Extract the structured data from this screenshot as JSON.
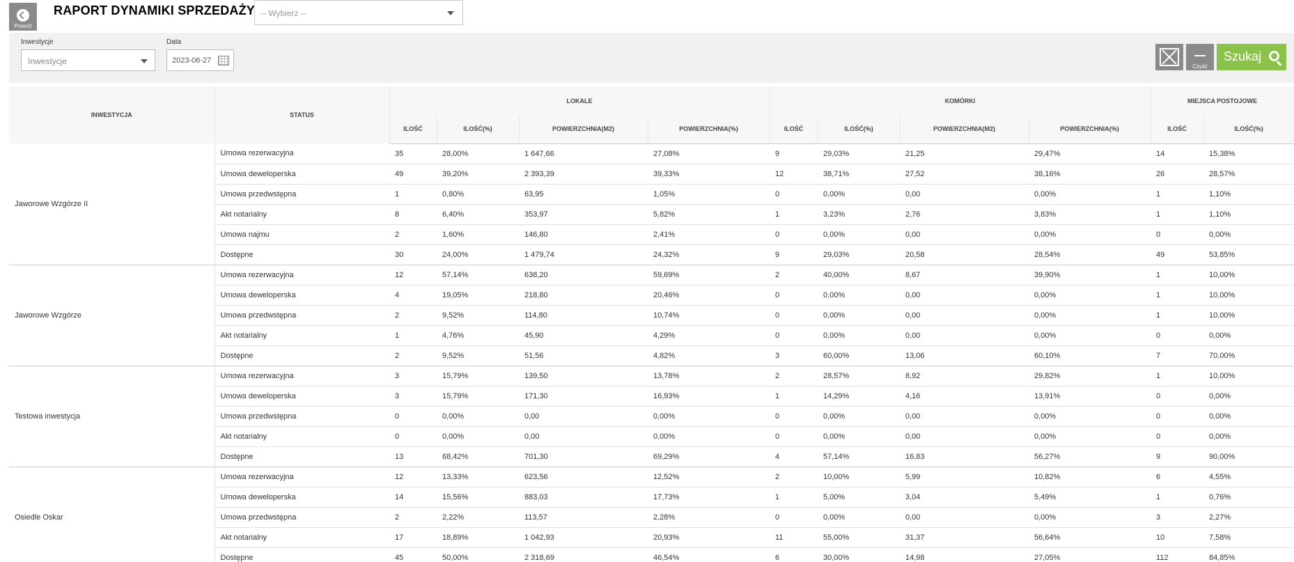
{
  "header": {
    "back_label": "Powrót",
    "title": "RAPORT DYNAMIKI SPRZEDAŻY",
    "report_select_placeholder": "-- Wybierz --"
  },
  "filters": {
    "investment_label": "Inwestycje",
    "investment_placeholder": "Inwestycje",
    "date_label": "Data",
    "date_value": "2023-06-27",
    "clear_label": "Czyść",
    "search_label": "Szukaj"
  },
  "table": {
    "head": {
      "investment": "INWESTYCJA",
      "status": "STATUS",
      "groups": [
        "LOKALE",
        "KOMÓRKI",
        "MIEJSCA POSTOJOWE"
      ],
      "cols": [
        "ILOŚĆ",
        "ILOŚĆ(%)",
        "POWIERZCHNIA(M2)",
        "POWIERZCHNIA(%)",
        "ILOŚĆ",
        "ILOŚĆ(%)",
        "POWIERZCHNIA(M2)",
        "POWIERZCHNIA(%)",
        "ILOŚĆ",
        "ILOŚĆ(%)"
      ]
    },
    "groups": [
      {
        "investment": "Jaworowe Wzgórze II",
        "rows": [
          {
            "status": "Umowa rezerwacyjna",
            "cells": [
              "35",
              "28,00%",
              "1 647,66",
              "27,08%",
              "9",
              "29,03%",
              "21,25",
              "29,47%",
              "14",
              "15,38%"
            ]
          },
          {
            "status": "Umowa deweloperska",
            "cells": [
              "49",
              "39,20%",
              "2 393,39",
              "39,33%",
              "12",
              "38,71%",
              "27,52",
              "38,16%",
              "26",
              "28,57%"
            ]
          },
          {
            "status": "Umowa przedwstępna",
            "cells": [
              "1",
              "0,80%",
              "63,95",
              "1,05%",
              "0",
              "0,00%",
              "0,00",
              "0,00%",
              "1",
              "1,10%"
            ]
          },
          {
            "status": "Akt notarialny",
            "cells": [
              "8",
              "6,40%",
              "353,97",
              "5,82%",
              "1",
              "3,23%",
              "2,76",
              "3,83%",
              "1",
              "1,10%"
            ]
          },
          {
            "status": "Umowa najmu",
            "cells": [
              "2",
              "1,60%",
              "146,80",
              "2,41%",
              "0",
              "0,00%",
              "0,00",
              "0,00%",
              "0",
              "0,00%"
            ]
          },
          {
            "status": "Dostępne",
            "cells": [
              "30",
              "24,00%",
              "1 479,74",
              "24,32%",
              "9",
              "29,03%",
              "20,58",
              "28,54%",
              "49",
              "53,85%"
            ]
          }
        ]
      },
      {
        "investment": "Jaworowe Wzgórze",
        "rows": [
          {
            "status": "Umowa rezerwacyjna",
            "cells": [
              "12",
              "57,14%",
              "638,20",
              "59,69%",
              "2",
              "40,00%",
              "8,67",
              "39,90%",
              "1",
              "10,00%"
            ]
          },
          {
            "status": "Umowa deweloperska",
            "cells": [
              "4",
              "19,05%",
              "218,80",
              "20,46%",
              "0",
              "0,00%",
              "0,00",
              "0,00%",
              "1",
              "10,00%"
            ]
          },
          {
            "status": "Umowa przedwstępna",
            "cells": [
              "2",
              "9,52%",
              "114,80",
              "10,74%",
              "0",
              "0,00%",
              "0,00",
              "0,00%",
              "1",
              "10,00%"
            ]
          },
          {
            "status": "Akt notarialny",
            "cells": [
              "1",
              "4,76%",
              "45,90",
              "4,29%",
              "0",
              "0,00%",
              "0,00",
              "0,00%",
              "0",
              "0,00%"
            ]
          },
          {
            "status": "Dostępne",
            "cells": [
              "2",
              "9,52%",
              "51,56",
              "4,82%",
              "3",
              "60,00%",
              "13,06",
              "60,10%",
              "7",
              "70,00%"
            ]
          }
        ]
      },
      {
        "investment": "Testowa inwestycja",
        "rows": [
          {
            "status": "Umowa rezerwacyjna",
            "cells": [
              "3",
              "15,79%",
              "139,50",
              "13,78%",
              "2",
              "28,57%",
              "8,92",
              "29,82%",
              "1",
              "10,00%"
            ]
          },
          {
            "status": "Umowa deweloperska",
            "cells": [
              "3",
              "15,79%",
              "171,30",
              "16,93%",
              "1",
              "14,29%",
              "4,16",
              "13,91%",
              "0",
              "0,00%"
            ]
          },
          {
            "status": "Umowa przedwstępna",
            "cells": [
              "0",
              "0,00%",
              "0,00",
              "0,00%",
              "0",
              "0,00%",
              "0,00",
              "0,00%",
              "0",
              "0,00%"
            ]
          },
          {
            "status": "Akt notarialny",
            "cells": [
              "0",
              "0,00%",
              "0,00",
              "0,00%",
              "0",
              "0,00%",
              "0,00",
              "0,00%",
              "0",
              "0,00%"
            ]
          },
          {
            "status": "Dostępne",
            "cells": [
              "13",
              "68,42%",
              "701,30",
              "69,29%",
              "4",
              "57,14%",
              "16,83",
              "56,27%",
              "9",
              "90,00%"
            ]
          }
        ]
      },
      {
        "investment": "Osiedle Oskar",
        "rows": [
          {
            "status": "Umowa rezerwacyjna",
            "cells": [
              "12",
              "13,33%",
              "623,56",
              "12,52%",
              "2",
              "10,00%",
              "5,99",
              "10,82%",
              "6",
              "4,55%"
            ]
          },
          {
            "status": "Umowa deweloperska",
            "cells": [
              "14",
              "15,56%",
              "883,03",
              "17,73%",
              "1",
              "5,00%",
              "3,04",
              "5,49%",
              "1",
              "0,76%"
            ]
          },
          {
            "status": "Umowa przedwstępna",
            "cells": [
              "2",
              "2,22%",
              "113,57",
              "2,28%",
              "0",
              "0,00%",
              "0,00",
              "0,00%",
              "3",
              "2,27%"
            ]
          },
          {
            "status": "Akt notarialny",
            "cells": [
              "17",
              "18,89%",
              "1 042,93",
              "20,93%",
              "11",
              "55,00%",
              "31,37",
              "56,64%",
              "10",
              "7,58%"
            ]
          },
          {
            "status": "Dostępne",
            "cells": [
              "45",
              "50,00%",
              "2 318,69",
              "46,54%",
              "6",
              "30,00%",
              "14,98",
              "27,05%",
              "112",
              "84,85%"
            ]
          }
        ]
      }
    ]
  }
}
